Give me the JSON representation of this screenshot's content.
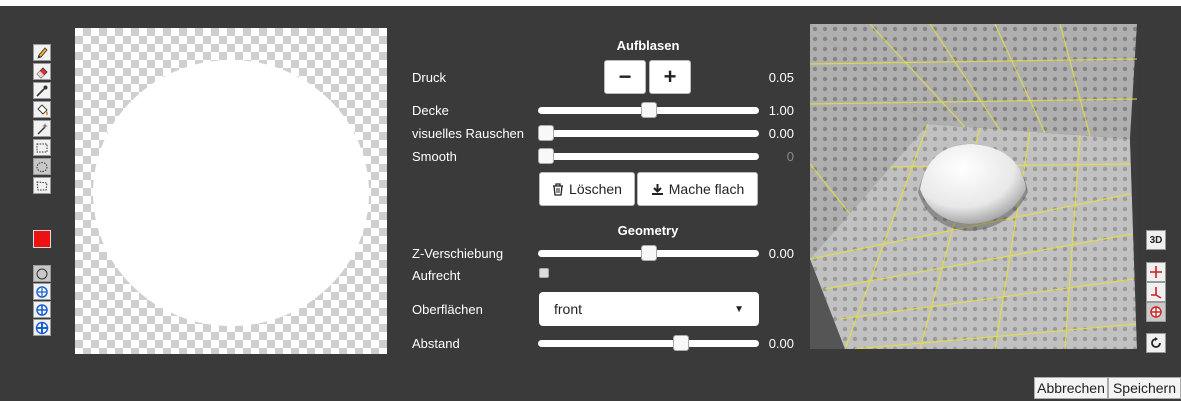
{
  "inflate": {
    "title": "Aufblasen",
    "pressure": {
      "label": "Druck",
      "minus": "−",
      "plus": "+",
      "value": "0.05"
    },
    "ceiling": {
      "label": "Decke",
      "value": "1.00",
      "level": 0.5
    },
    "noise": {
      "label": "visuelles Rauschen",
      "value": "0.00",
      "level": 0.0
    },
    "smooth": {
      "label": "Smooth",
      "value": "0",
      "level": 0.0
    },
    "clear_button": "Löschen",
    "flatten_button": "Mache flach"
  },
  "geometry": {
    "title": "Geometry",
    "z_shift": {
      "label": "Z-Verschiebung",
      "value": "0.00",
      "level": 0.5
    },
    "upright": {
      "label": "Aufrecht",
      "checked": false
    },
    "surfaces": {
      "label": "Oberflächen",
      "selected": "front"
    },
    "distance": {
      "label": "Abstand",
      "value": "0.00",
      "level": 0.66
    }
  },
  "tools": [
    "pencil-icon",
    "eraser-icon",
    "eyedropper-icon",
    "paint-bucket-icon",
    "magic-wand-icon",
    "rect-select-icon",
    "ellipse-select-icon",
    "lasso-select-icon"
  ],
  "brush_color": "#ee1111",
  "view_buttons": {
    "mode_3d": "3D"
  },
  "footer": {
    "cancel": "Abbrechen",
    "save": "Speichern"
  }
}
